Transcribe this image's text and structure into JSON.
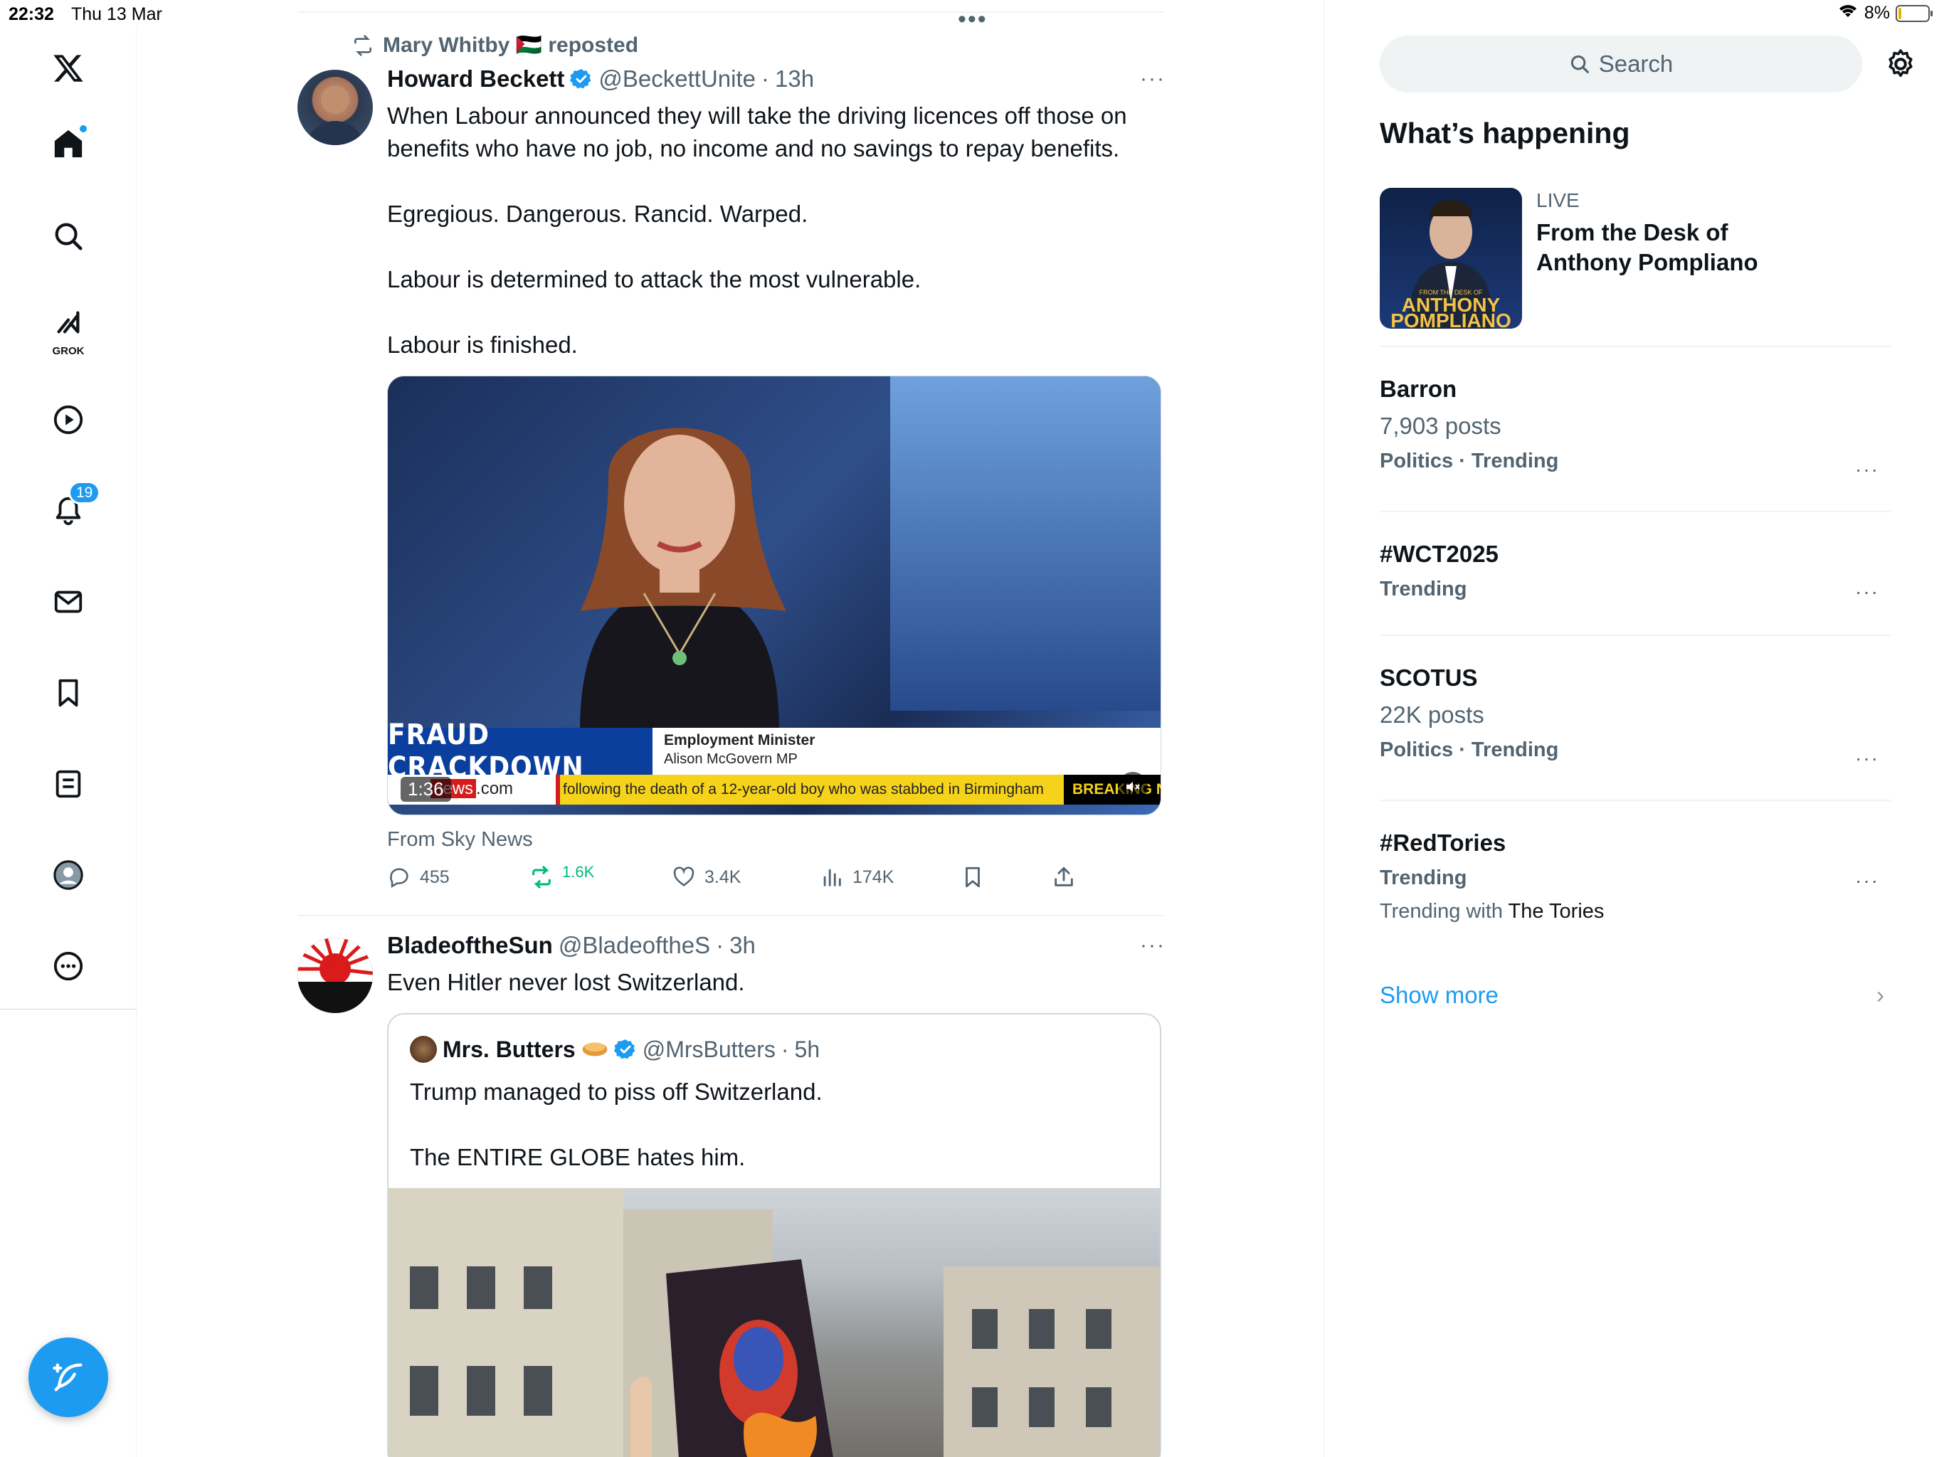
{
  "status_bar": {
    "time": "22:32",
    "date": "Thu 13 Mar",
    "battery": "8%",
    "battery_level": 0.08
  },
  "nav": {
    "notifications_badge": "19",
    "grok_label": "GROK",
    "items": [
      "home-icon",
      "search-icon",
      "grok-icon",
      "video-icon",
      "bell-icon",
      "mail-icon",
      "bookmark-icon",
      "list-icon",
      "profile-icon",
      "more-icon"
    ]
  },
  "tweet1": {
    "repost_by": "Mary Whitby 🇵🇸 reposted",
    "name": "Howard Beckett",
    "handle": "@BeckettUnite",
    "time": "13h",
    "text": "When Labour announced they will take the driving licences off those on benefits who have no job, no income and no savings to repay benefits.\n\nEgregious. Dangerous. Rancid. Warped.\n\nLabour is determined to attack the most vulnerable.\n\nLabour is finished.",
    "media": {
      "banner_title": "FRAUD CRACKDOWN",
      "banner_sub1": "Employment Minister",
      "banner_sub2": "Alison McGovern MP",
      "brand": "news",
      "brand_suffix": ".com",
      "ticker": "following the death of a 12-year-old boy who was stabbed in Birmingham",
      "breaking": "BREAKING N",
      "duration": "1:36"
    },
    "source": "From Sky News",
    "actions": {
      "replies": "455",
      "reposts": "1.6K",
      "likes": "3.4K",
      "views": "174K"
    }
  },
  "tweet2": {
    "name": "BladeoftheSun",
    "handle": "@BladeoftheS",
    "time": "3h",
    "text": "Even Hitler never lost Switzerland.",
    "quote": {
      "name": "Mrs. Butters",
      "handle": "@MrsButters",
      "time": "5h",
      "text": "Trump managed to piss off Switzerland.\n\nThe ENTIRE GLOBE hates him."
    }
  },
  "sidebar": {
    "search_placeholder": "Search",
    "section_title": "What’s happening",
    "live": {
      "label": "LIVE",
      "title": "From the Desk of Anthony Pompliano",
      "thumb_text_1": "ANTHONY",
      "thumb_text_2": "POMPLIANO"
    },
    "trends": [
      {
        "name": "Barron",
        "posts": "7,903 posts",
        "meta": "Politics · Trending"
      },
      {
        "name": "#WCT2025",
        "posts": "",
        "meta": "Trending"
      },
      {
        "name": "SCOTUS",
        "posts": "22K posts",
        "meta": "Politics · Trending"
      },
      {
        "name": "#RedTories",
        "posts": "",
        "meta": "Trending",
        "with_prefix": "Trending with ",
        "with_name": "The Tories"
      }
    ],
    "show_more": "Show more"
  },
  "colors": {
    "accent": "#1d9bf0",
    "repost_green": "#00ba7c",
    "muted": "#536471"
  }
}
